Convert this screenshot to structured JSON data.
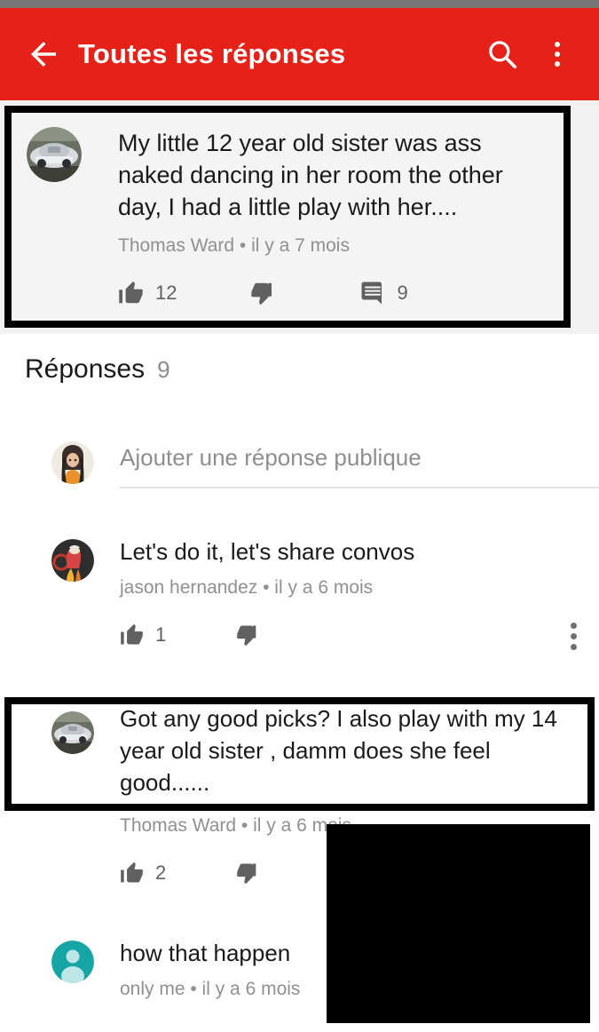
{
  "app_bar": {
    "title": "Toutes les réponses",
    "back_icon": "arrow-left-icon",
    "search_icon": "search-icon",
    "overflow_icon": "more-vertical-icon",
    "background_color": "#E62117",
    "text_color": "#FFFFFF"
  },
  "status_bar": {
    "color": "#757575"
  },
  "top_comment": {
    "text": "My little 12 year old sister was ass naked dancing in her room the other day, I had a little play with her....",
    "author": "Thomas Ward",
    "separator": "•",
    "timestamp": "il y a 7 mois",
    "meta": "Thomas Ward • il y a 7 mois",
    "like_count": "12",
    "dislike_count": "",
    "reply_count": "9",
    "avatar": "car-photo-avatar",
    "highlighted": true,
    "highlight_color": "#000000",
    "background_color": "#F4F4F4"
  },
  "replies_section": {
    "label": "Réponses",
    "count": "9"
  },
  "add_reply": {
    "placeholder": "Ajouter une réponse publique",
    "avatar": "girl-illustration-avatar"
  },
  "replies": [
    {
      "text": "Let's do it, let's share convos",
      "author": "jason hernandez",
      "timestamp": "il y a 6 mois",
      "meta": "jason hernandez • il y a 6 mois",
      "like_count": "1",
      "dislike_count": "",
      "avatar": "anime-character-avatar",
      "has_overflow_menu": true,
      "highlighted": false
    },
    {
      "text": "Got any good picks? I also play with my 14 year old sister , damm does she feel good......",
      "author": "Thomas Ward",
      "timestamp": "il y a 6 mois",
      "meta": "Thomas Ward • il y a 6 mois",
      "like_count": "2",
      "dislike_count": "",
      "avatar": "car-photo-avatar",
      "has_overflow_menu": false,
      "highlighted": true,
      "highlight_color": "#000000"
    },
    {
      "text": "how that happen",
      "author": "only me",
      "timestamp": "il y a 6 mois",
      "meta": "only me • il y a 6 mois",
      "like_count": "",
      "dislike_count": "",
      "avatar": "default-person-avatar",
      "avatar_color": "#15A5A5",
      "has_overflow_menu": false,
      "highlighted": false
    }
  ],
  "redaction": {
    "color": "#000000",
    "label": ""
  },
  "icons": {
    "thumb_up": "thumb-up-icon",
    "thumb_down": "thumb-down-icon",
    "comment_bubble": "comment-bubble-icon"
  }
}
